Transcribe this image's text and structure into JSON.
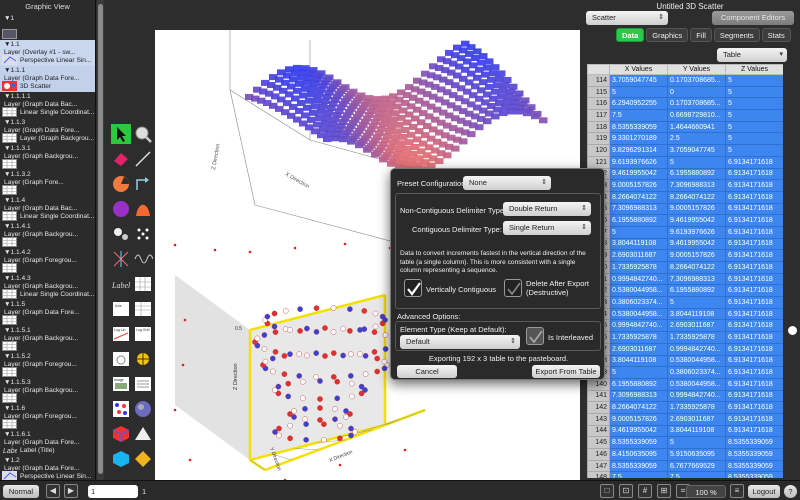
{
  "left_panel": {
    "title": "Graphic View",
    "layers": [
      {
        "index": "▼1",
        "line1": "",
        "line2": "",
        "icon": "plot-icon"
      },
      {
        "index": "▼1.1",
        "line1": "Layer (Overlay #1 - sw...",
        "line2": "Perspective Linear Sin...",
        "icon": "perspective-icon"
      },
      {
        "index": "▼1.1.1",
        "line1": "Layer (Graph Data Fore...",
        "line2": "3D Scatter",
        "icon": "scatter-3d-icon"
      },
      {
        "index": "▼1.1.1.1",
        "line1": "Layer (Graph Data Bac...",
        "line2": "Linear Single Coordinat...",
        "icon": "grid-icon"
      },
      {
        "index": "▼1.1.3",
        "line1": "Layer (Graph Data Fore...",
        "line2": "Layer (Graph Backgrou...",
        "icon": "grid-icon"
      },
      {
        "index": "▼1.1.3.1",
        "line1": "Layer (Graph Backgrou...",
        "line2": "",
        "icon": "grid-icon"
      },
      {
        "index": "▼1.1.3.2",
        "line1": "Layer (Graph Fore...",
        "line2": "",
        "icon": "grid-icon"
      },
      {
        "index": "▼1.1.4",
        "line1": "Layer (Graph Data Bac...",
        "line2": "Linear Single Coordinat...",
        "icon": "grid-icon"
      },
      {
        "index": "▼1.1.4.1",
        "line1": "Layer (Graph Backgrou...",
        "line2": "",
        "icon": "grid-icon"
      },
      {
        "index": "▼1.1.4.2",
        "line1": "Layer (Graph Foregrou...",
        "line2": "",
        "icon": "grid-icon"
      },
      {
        "index": "▼1.1.4.3",
        "line1": "Layer (Graph Backgrou...",
        "line2": "Linear Single Coordinat...",
        "icon": "grid-icon"
      },
      {
        "index": "▼1.1.5",
        "line1": "Layer (Graph Data Fore...",
        "line2": "",
        "icon": "grid-icon"
      },
      {
        "index": "▼1.1.5.1",
        "line1": "Layer (Graph Backgrou...",
        "line2": "",
        "icon": "grid-icon"
      },
      {
        "index": "▼1.1.5.2",
        "line1": "Layer (Graph Foregrou...",
        "line2": "",
        "icon": "grid-icon"
      },
      {
        "index": "▼1.1.5.3",
        "line1": "Layer (Graph Backgrou...",
        "line2": "",
        "icon": "grid-icon"
      },
      {
        "index": "▼1.1.6",
        "line1": "Layer (Graph Foregrou...",
        "line2": "",
        "icon": "grid-icon"
      },
      {
        "index": "▼1.1.6.1",
        "line1": "Layer (Graph Data Fore...",
        "line2": "Label (Title)",
        "icon": "label-icon"
      },
      {
        "index": "▼1.2",
        "line1": "Layer (Graph Data Fore...",
        "line2": "Perspective Linear Sin...",
        "icon": "perspective-icon"
      },
      {
        "index": "▼1.2.1",
        "line1": "Layer (Graph Data Fore...",
        "line2": "3D Point Map",
        "icon": "point-map-icon"
      }
    ]
  },
  "tools": [
    {
      "name": "pointer-tool-icon",
      "row": 0,
      "col": 0
    },
    {
      "name": "magnifier-tool-icon",
      "row": 0,
      "col": 1
    },
    {
      "name": "eraser-tool-icon",
      "row": 1,
      "col": 0
    },
    {
      "name": "line-tool-icon",
      "row": 1,
      "col": 1
    },
    {
      "name": "pie-tool-icon",
      "row": 2,
      "col": 0
    },
    {
      "name": "arrow-tool-icon",
      "row": 2,
      "col": 1
    },
    {
      "name": "circle-tool-icon",
      "row": 3,
      "col": 0
    },
    {
      "name": "curve-tool-icon",
      "row": 3,
      "col": 1
    },
    {
      "name": "bubbles-tool-icon",
      "row": 4,
      "col": 0
    },
    {
      "name": "dots-tool-icon",
      "row": 4,
      "col": 1
    },
    {
      "name": "spark-tool-icon",
      "row": 5,
      "col": 0
    },
    {
      "name": "wave-tool-icon",
      "row": 5,
      "col": 1
    },
    {
      "name": "label-tool-icon",
      "row": 6,
      "col": 0
    },
    {
      "name": "grid-tool-icon",
      "row": 6,
      "col": 1
    },
    {
      "name": "axis-tool-icon",
      "row": 7,
      "col": 0
    },
    {
      "name": "table-tool-icon",
      "row": 7,
      "col": 1
    },
    {
      "name": "log-tool-icon",
      "row": 8,
      "col": 0
    },
    {
      "name": "log-grid-tool-icon",
      "row": 8,
      "col": 1
    },
    {
      "name": "polar-tool-icon",
      "row": 9,
      "col": 0
    },
    {
      "name": "compass-tool-icon",
      "row": 9,
      "col": 1
    },
    {
      "name": "image-tool-icon",
      "row": 10,
      "col": 0
    },
    {
      "name": "sheet-tool-icon",
      "row": 10,
      "col": 1
    },
    {
      "name": "scatter-grid-tool-icon",
      "row": 11,
      "col": 0
    },
    {
      "name": "sphere-tool-icon",
      "row": 11,
      "col": 1
    },
    {
      "name": "cube-tool-icon",
      "row": 12,
      "col": 0
    },
    {
      "name": "pyramid-tool-icon",
      "row": 12,
      "col": 1
    },
    {
      "name": "box-tool-icon",
      "row": 13,
      "col": 0
    },
    {
      "name": "diamond-tool-icon",
      "row": 13,
      "col": 1
    }
  ],
  "tool_labels": {
    "label": "Label",
    "axis": "Axis",
    "table": "Table",
    "log": "Log Lin",
    "log_grid": "Log Grid",
    "polar": "Polar",
    "image": "Image",
    "sheet": "Sheet"
  },
  "canvas": {
    "top_axis_labels": {
      "x": "X Direction",
      "y": "Y Direction",
      "z": "Z Direction"
    },
    "bottom_axis_labels": {
      "x": "X Direction",
      "y": "Y Direction",
      "z": "Z Direction"
    },
    "bottom_tick_label": "0.5"
  },
  "right_panel": {
    "window_title": "Untitled 3D Scatter",
    "type_popup": "Scatter",
    "component_editors": "Component Editors",
    "tabs": [
      {
        "label": "Data",
        "active": true
      },
      {
        "label": "Graphics",
        "active": false
      },
      {
        "label": "Fill",
        "active": false
      },
      {
        "label": "Segments",
        "active": false
      },
      {
        "label": "Stats",
        "active": false
      }
    ],
    "view_popup": "Table",
    "columns": [
      "",
      "X Values",
      "Y Values",
      "Z Values"
    ],
    "rows": [
      [
        "114",
        "3.7059047745",
        "0.1703708685...",
        "5"
      ],
      [
        "115",
        "5",
        "0",
        "5"
      ],
      [
        "116",
        "6.2940952255",
        "0.1703708685...",
        "5"
      ],
      [
        "117",
        "7.5",
        "0.6698729810...",
        "5"
      ],
      [
        "118",
        "8.5355339059",
        "1.4644660941",
        "5"
      ],
      [
        "119",
        "9.3301270189",
        "2.5",
        "5"
      ],
      [
        "120",
        "9.8296291314",
        "3.7059047745",
        "5"
      ],
      [
        "121",
        "9.6193976626",
        "5",
        "6.9134171618"
      ],
      [
        "122",
        "9.4619955042",
        "6.1955880892",
        "6.9134171618"
      ],
      [
        "123",
        "9.0005157826",
        "7.3096988313",
        "6.9134171618"
      ],
      [
        "124",
        "8.2664074122",
        "8.2664074122",
        "6.9134171618"
      ],
      [
        "125",
        "7.3096988313",
        "9.0005157826",
        "6.9134171618"
      ],
      [
        "126",
        "6.1955880892",
        "9.4619955042",
        "6.9134171618"
      ],
      [
        "127",
        "5",
        "9.6193976626",
        "6.9134171618"
      ],
      [
        "128",
        "3.8044119108",
        "9.4619955042",
        "6.9134171618"
      ],
      [
        "129",
        "2.6903011687",
        "9.0005157826",
        "6.9134171618"
      ],
      [
        "130",
        "1.7335925878",
        "8.2664074122",
        "6.9134171618"
      ],
      [
        "131",
        "0.9994842740...",
        "7.3096988313",
        "6.9134171618"
      ],
      [
        "132",
        "0.5380044958...",
        "6.1955880892",
        "6.9134171618"
      ],
      [
        "133",
        "0.3806023374...",
        "5",
        "6.9134171618"
      ],
      [
        "134",
        "0.5380044958...",
        "3.8044119108",
        "6.9134171618"
      ],
      [
        "135",
        "0.9994842740...",
        "2.6903011687",
        "6.9134171618"
      ],
      [
        "136",
        "1.7335925878",
        "1.7335925878",
        "6.9134171618"
      ],
      [
        "137",
        "2.6903011687",
        "0.9994842740...",
        "6.9134171618"
      ],
      [
        "138",
        "3.8044119108",
        "0.5380044958...",
        "6.9134171618"
      ],
      [
        "139",
        "5",
        "0.3806023374...",
        "6.9134171618"
      ],
      [
        "140",
        "6.1955880892",
        "0.5380044958...",
        "6.9134171618"
      ],
      [
        "141",
        "7.3096988313",
        "0.9994842740...",
        "6.9134171618"
      ],
      [
        "142",
        "8.2664074122",
        "1.7335925878",
        "6.9134171618"
      ],
      [
        "143",
        "9.0005157826",
        "2.6903011687",
        "6.9134171618"
      ],
      [
        "144",
        "9.4619955042",
        "3.8044119108",
        "6.9134171618"
      ],
      [
        "145",
        "8.5355339059",
        "5",
        "8.5355339059"
      ],
      [
        "146",
        "8.4150635095",
        "5.9150635095",
        "8.5355339059"
      ],
      [
        "147",
        "8.5355339059",
        "6.7677669529",
        "8.5355339059"
      ],
      [
        "148",
        "7.5",
        "7.5",
        "8.5355339059"
      ],
      [
        "149",
        "6.7677669529",
        "8.0618621785",
        "8.5355339059"
      ]
    ]
  },
  "dialog": {
    "preset_label": "Preset Configuration:",
    "preset_value": "None",
    "noncontig_label": "Non-Contiguous Delimiter Type:",
    "noncontig_value": "Double Return",
    "contig_label": "Contiguous Delimiter Type:",
    "contig_value": "Single Return",
    "description": "Data to convert increments fastest in the vertical direction of the table (a single column). This is more consistent with a single column representing a sequence.",
    "vertically_contiguous": "Vertically Contiguous",
    "delete_after_export": "Delete After Export (Destructive)",
    "advanced_label": "Advanced Options:",
    "element_type_label": "Element Type (Keep at Default):",
    "element_type_value": "Default",
    "is_interleaved": "Is Interleaved",
    "export_status": "Exporting 192 x 3 table to the pasteboard.",
    "cancel": "Cancel",
    "export_button": "Export From Table"
  },
  "bottom_bar": {
    "mode": "Normal",
    "page_field": "1",
    "page_count": "1",
    "zoom": "100 %",
    "logout": "Logout",
    "help": "?"
  },
  "colors": {
    "accent_green": "#2bc84a",
    "selection_blue": "#3d86ef",
    "surface_red": "#e45a5a",
    "surface_blue": "#3a3ae8"
  }
}
